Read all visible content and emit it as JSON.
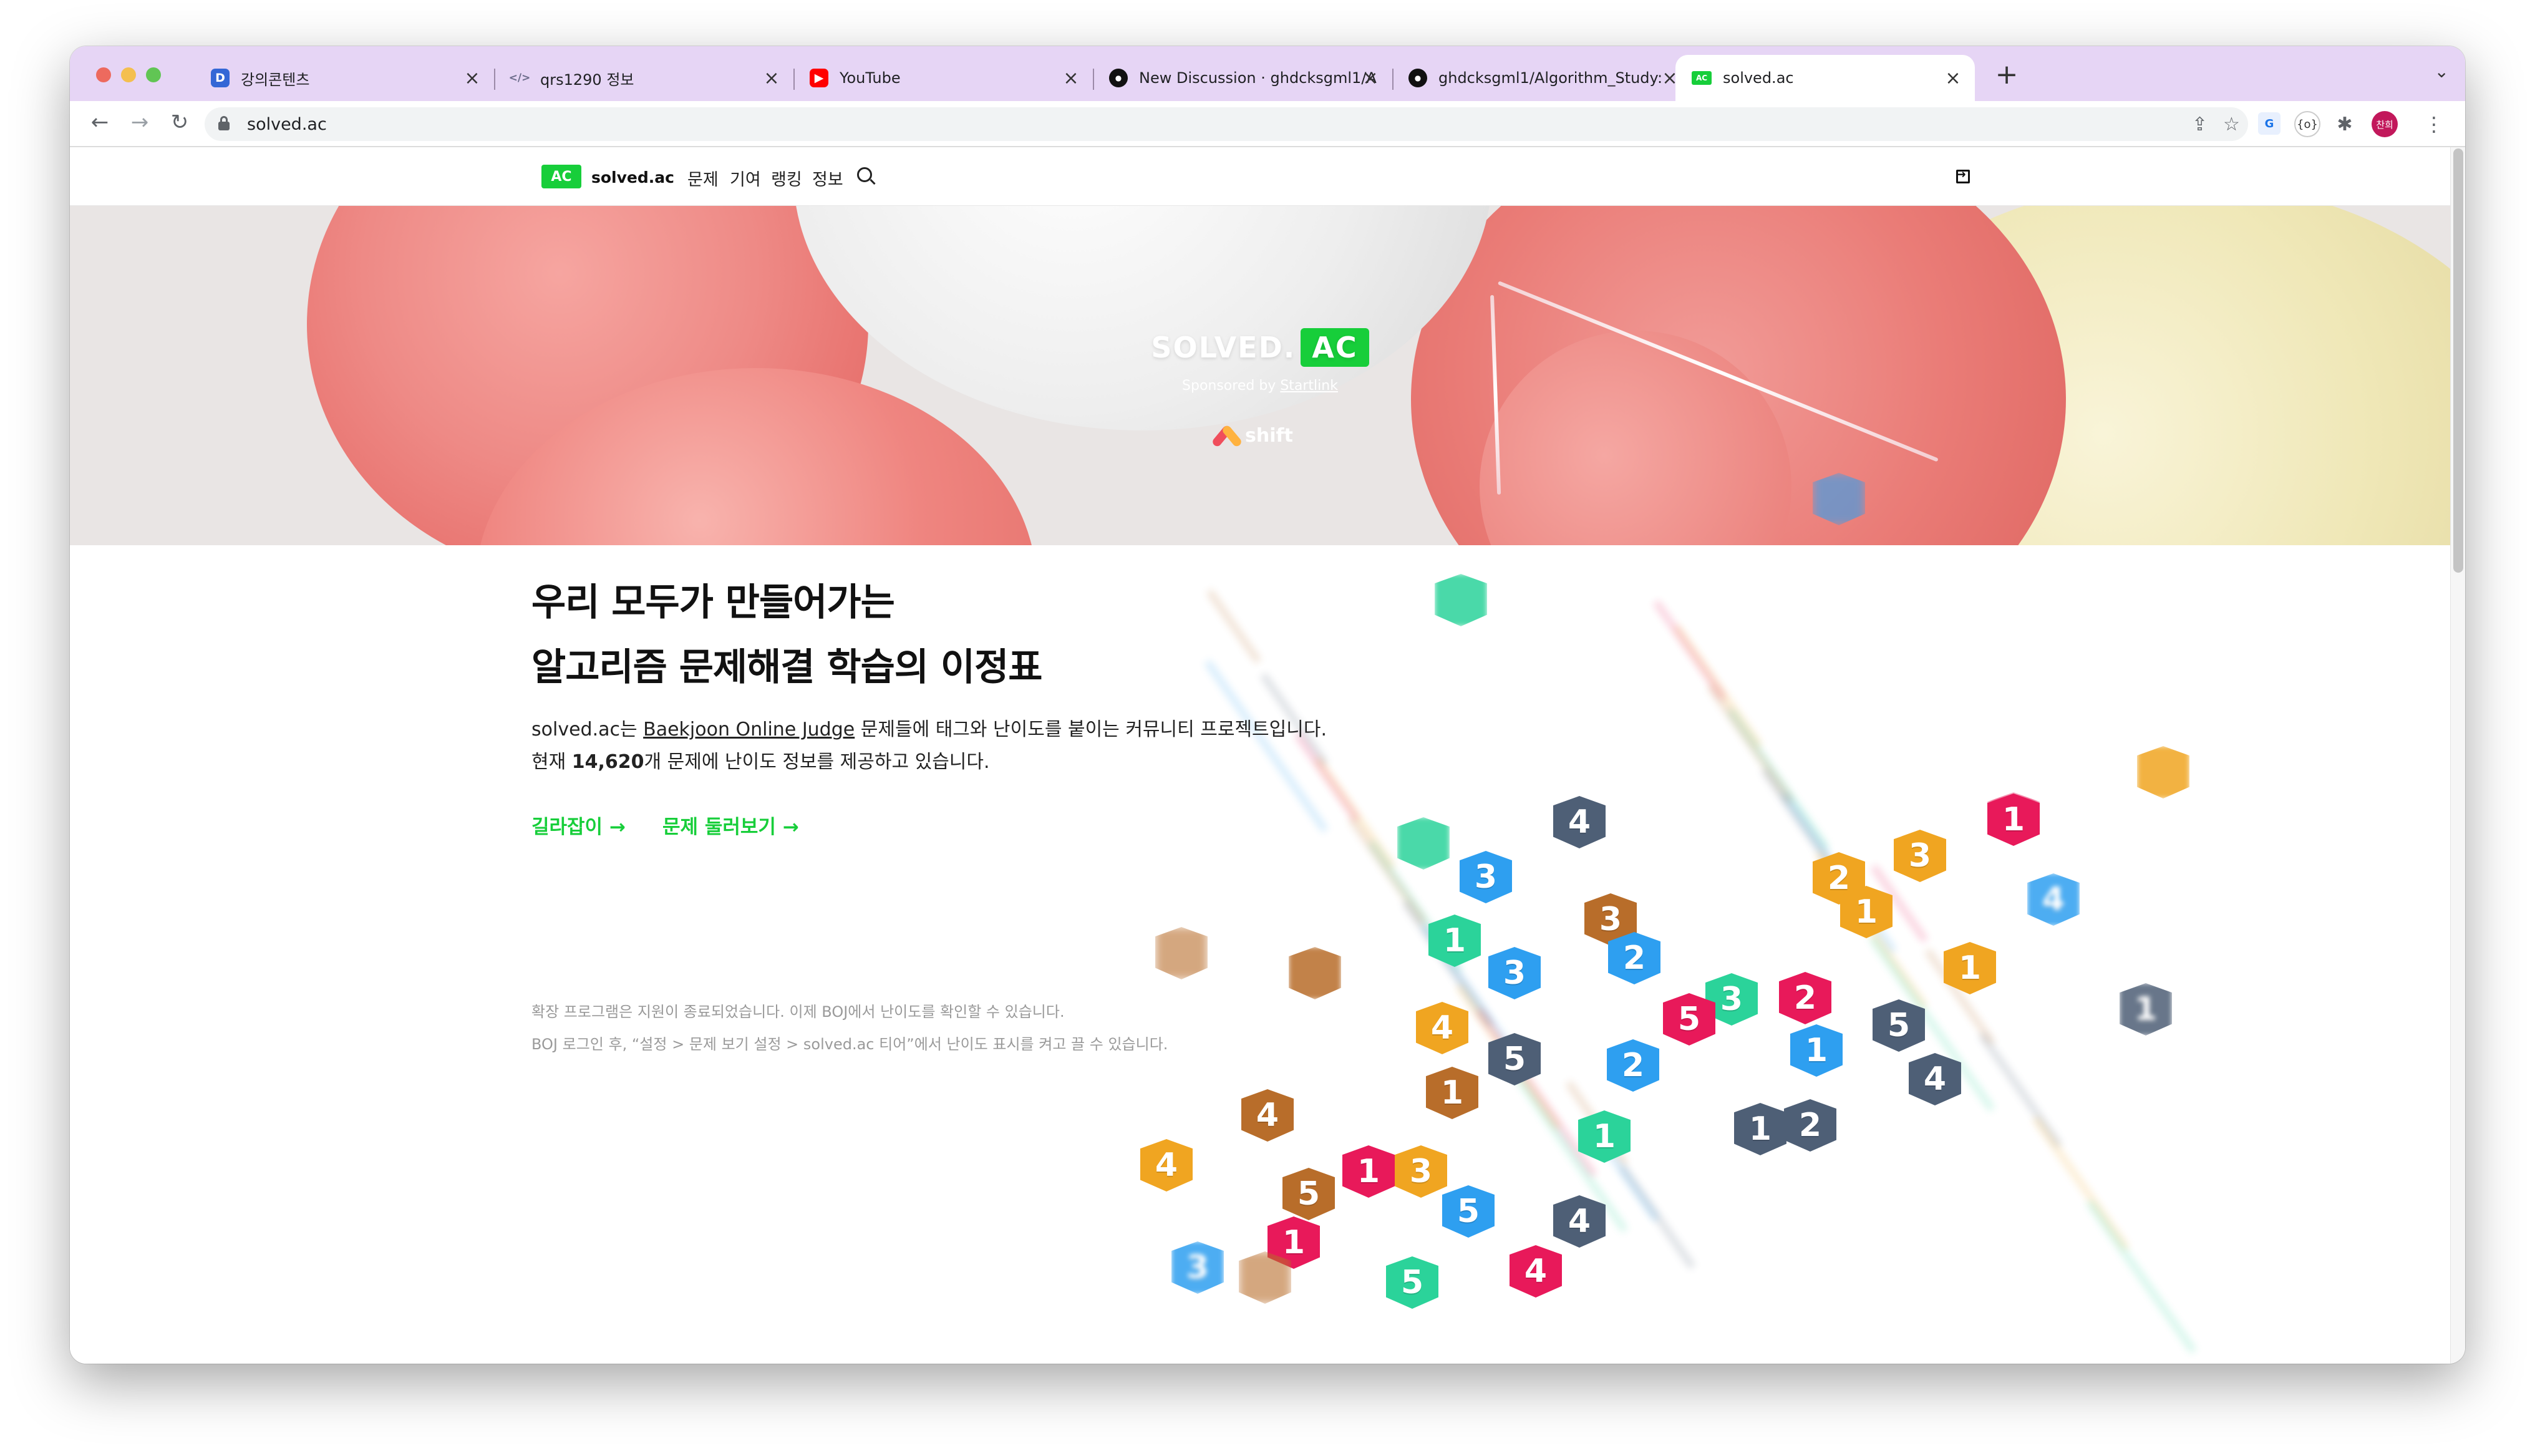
{
  "browser": {
    "tabs": [
      {
        "label": "강의콘텐츠",
        "icon": "document-icon",
        "favicon_text": "D",
        "favicon_color": "#3367d6"
      },
      {
        "label": "qrs1290 정보",
        "icon": "code-icon",
        "favicon_text": "</>",
        "favicon_color": "#6b6b8a"
      },
      {
        "label": "YouTube",
        "icon": "youtube-icon",
        "favicon_text": "▶",
        "favicon_color": "#ff0000"
      },
      {
        "label": "New Discussion · ghdcksgml1/A",
        "icon": "github-icon",
        "favicon_text": "●",
        "favicon_color": "#111111"
      },
      {
        "label": "ghdcksgml1/Algorithm_Study:",
        "icon": "github-icon",
        "favicon_text": "●",
        "favicon_color": "#111111"
      },
      {
        "label": "solved.ac",
        "icon": "solved-ac-icon",
        "favicon_text": "AC",
        "favicon_color": "#17ce3a"
      }
    ],
    "url": "solved.ac",
    "profile_initials": "찬희"
  },
  "site": {
    "logo_badge": "AC",
    "logo_text": "solved.ac",
    "nav": [
      "문제",
      "기여",
      "랭킹",
      "정보"
    ],
    "accent_color": "#17ce3a"
  },
  "hero": {
    "title_left": "SOLVED.",
    "title_badge": "AC",
    "sponsor_prefix": "Sponsored by ",
    "sponsor_link": "Startlink",
    "partner": "shift"
  },
  "main": {
    "headline_line1": "우리 모두가 만들어가는",
    "headline_line2": "알고리즘 문제해결 학습의 이정표",
    "desc_prefix": "solved.ac는 ",
    "desc_link": "Baekjoon Online Judge",
    "desc_suffix": " 문제들에 태그와 난이도를 붙이는 커뮤니티 프로젝트입니다.",
    "count_prefix": "현재 ",
    "count_value": "14,620",
    "count_suffix": "개 문제에 난이도 정보를 제공하고 있습니다.",
    "cta_guide": "길라잡이 →",
    "cta_browse": "문제 둘러보기 →",
    "note_line1": "확장 프로그램은 지원이 종료되었습니다. 이제 BOJ에서 난이도를 확인할 수 있습니다.",
    "note_line2": "BOJ 로그인 후, “설정 > 문제 보기 설정 > solved.ac 티어”에서 난이도 표시를 켜고 끌 수 있습니다."
  },
  "tier_colors": {
    "bronze": "#b86d2a",
    "silver": "#4e5f76",
    "gold": "#f0a521",
    "platinum": "#2bd39a",
    "diamond": "#2e9ff0",
    "ruby": "#e8195a"
  },
  "badges": [
    {
      "n": "",
      "tier": "diamond"
    },
    {
      "n": "",
      "tier": "platinum"
    },
    {
      "n": "",
      "tier": "ruby"
    },
    {
      "n": "1",
      "tier": "ruby"
    },
    {
      "n": "",
      "tier": "gold"
    },
    {
      "n": "4",
      "tier": "silver"
    },
    {
      "n": "3",
      "tier": "diamond"
    },
    {
      "n": "",
      "tier": "platinum"
    },
    {
      "n": "3",
      "tier": "gold"
    },
    {
      "n": "2",
      "tier": "gold"
    },
    {
      "n": "1",
      "tier": "gold"
    },
    {
      "n": "4",
      "tier": "diamond"
    },
    {
      "n": "",
      "tier": "bronze"
    },
    {
      "n": "",
      "tier": "bronze"
    },
    {
      "n": "1",
      "tier": "platinum"
    },
    {
      "n": "3",
      "tier": "diamond"
    },
    {
      "n": "3",
      "tier": "bronze"
    },
    {
      "n": "2",
      "tier": "diamond"
    },
    {
      "n": "1",
      "tier": "gold"
    },
    {
      "n": "3",
      "tier": "platinum"
    },
    {
      "n": "2",
      "tier": "ruby"
    },
    {
      "n": "5",
      "tier": "ruby"
    },
    {
      "n": "5",
      "tier": "silver"
    },
    {
      "n": "1",
      "tier": "silver"
    },
    {
      "n": "4",
      "tier": "gold"
    },
    {
      "n": "5",
      "tier": "silver"
    },
    {
      "n": "1",
      "tier": "diamond"
    },
    {
      "n": "4",
      "tier": "silver"
    },
    {
      "n": "1",
      "tier": "bronze"
    },
    {
      "n": "4",
      "tier": "bronze"
    },
    {
      "n": "1",
      "tier": "platinum"
    },
    {
      "n": "1",
      "tier": "silver"
    },
    {
      "n": "2",
      "tier": "silver"
    },
    {
      "n": "4",
      "tier": "gold"
    },
    {
      "n": "5",
      "tier": "bronze"
    },
    {
      "n": "1",
      "tier": "ruby"
    },
    {
      "n": "3",
      "tier": "gold"
    },
    {
      "n": "5",
      "tier": "diamond"
    },
    {
      "n": "4",
      "tier": "silver"
    },
    {
      "n": "1",
      "tier": "ruby"
    },
    {
      "n": "3",
      "tier": "diamond"
    },
    {
      "n": "",
      "tier": "bronze"
    },
    {
      "n": "5",
      "tier": "platinum"
    },
    {
      "n": "4",
      "tier": "ruby"
    },
    {
      "n": "2",
      "tier": "diamond"
    }
  ]
}
